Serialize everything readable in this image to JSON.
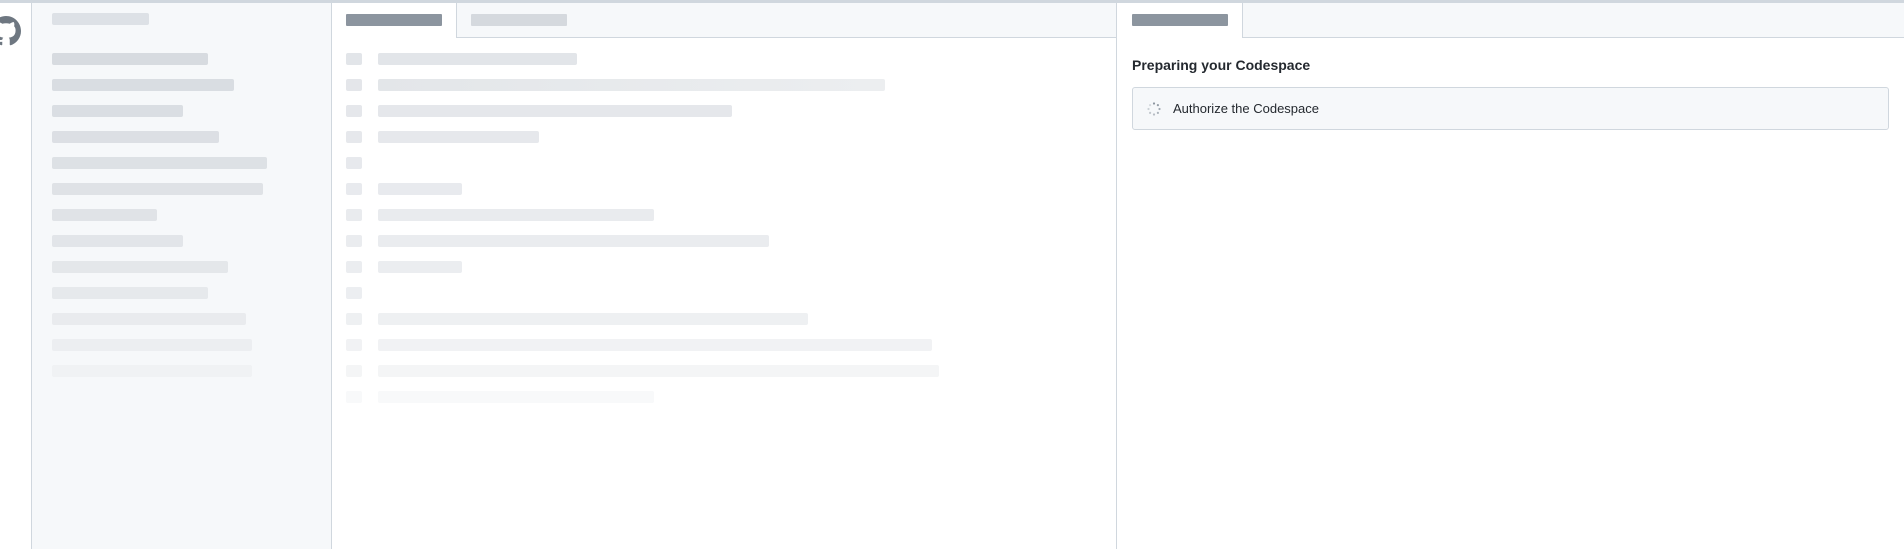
{
  "icons": {
    "activity_logo": "github-octocat-icon",
    "step_status": "loading-spinner-icon"
  },
  "colors": {
    "border": "#d0d7de",
    "sidebar_bg": "#f6f8fa",
    "placeholder_dark": "#8c959f",
    "text": "#24292f"
  },
  "editor": {
    "tabs": [
      "",
      ""
    ],
    "lines": [
      "",
      "",
      "",
      "",
      "",
      "",
      "",
      "",
      "",
      "",
      "",
      "",
      "",
      ""
    ]
  },
  "sidebar": {
    "items": [
      "",
      "",
      "",
      "",
      "",
      "",
      "",
      "",
      "",
      "",
      "",
      "",
      ""
    ]
  },
  "panel": {
    "heading": "Preparing your Codespace",
    "steps": [
      {
        "label": "Authorize the Codespace",
        "status": "in-progress"
      }
    ]
  }
}
